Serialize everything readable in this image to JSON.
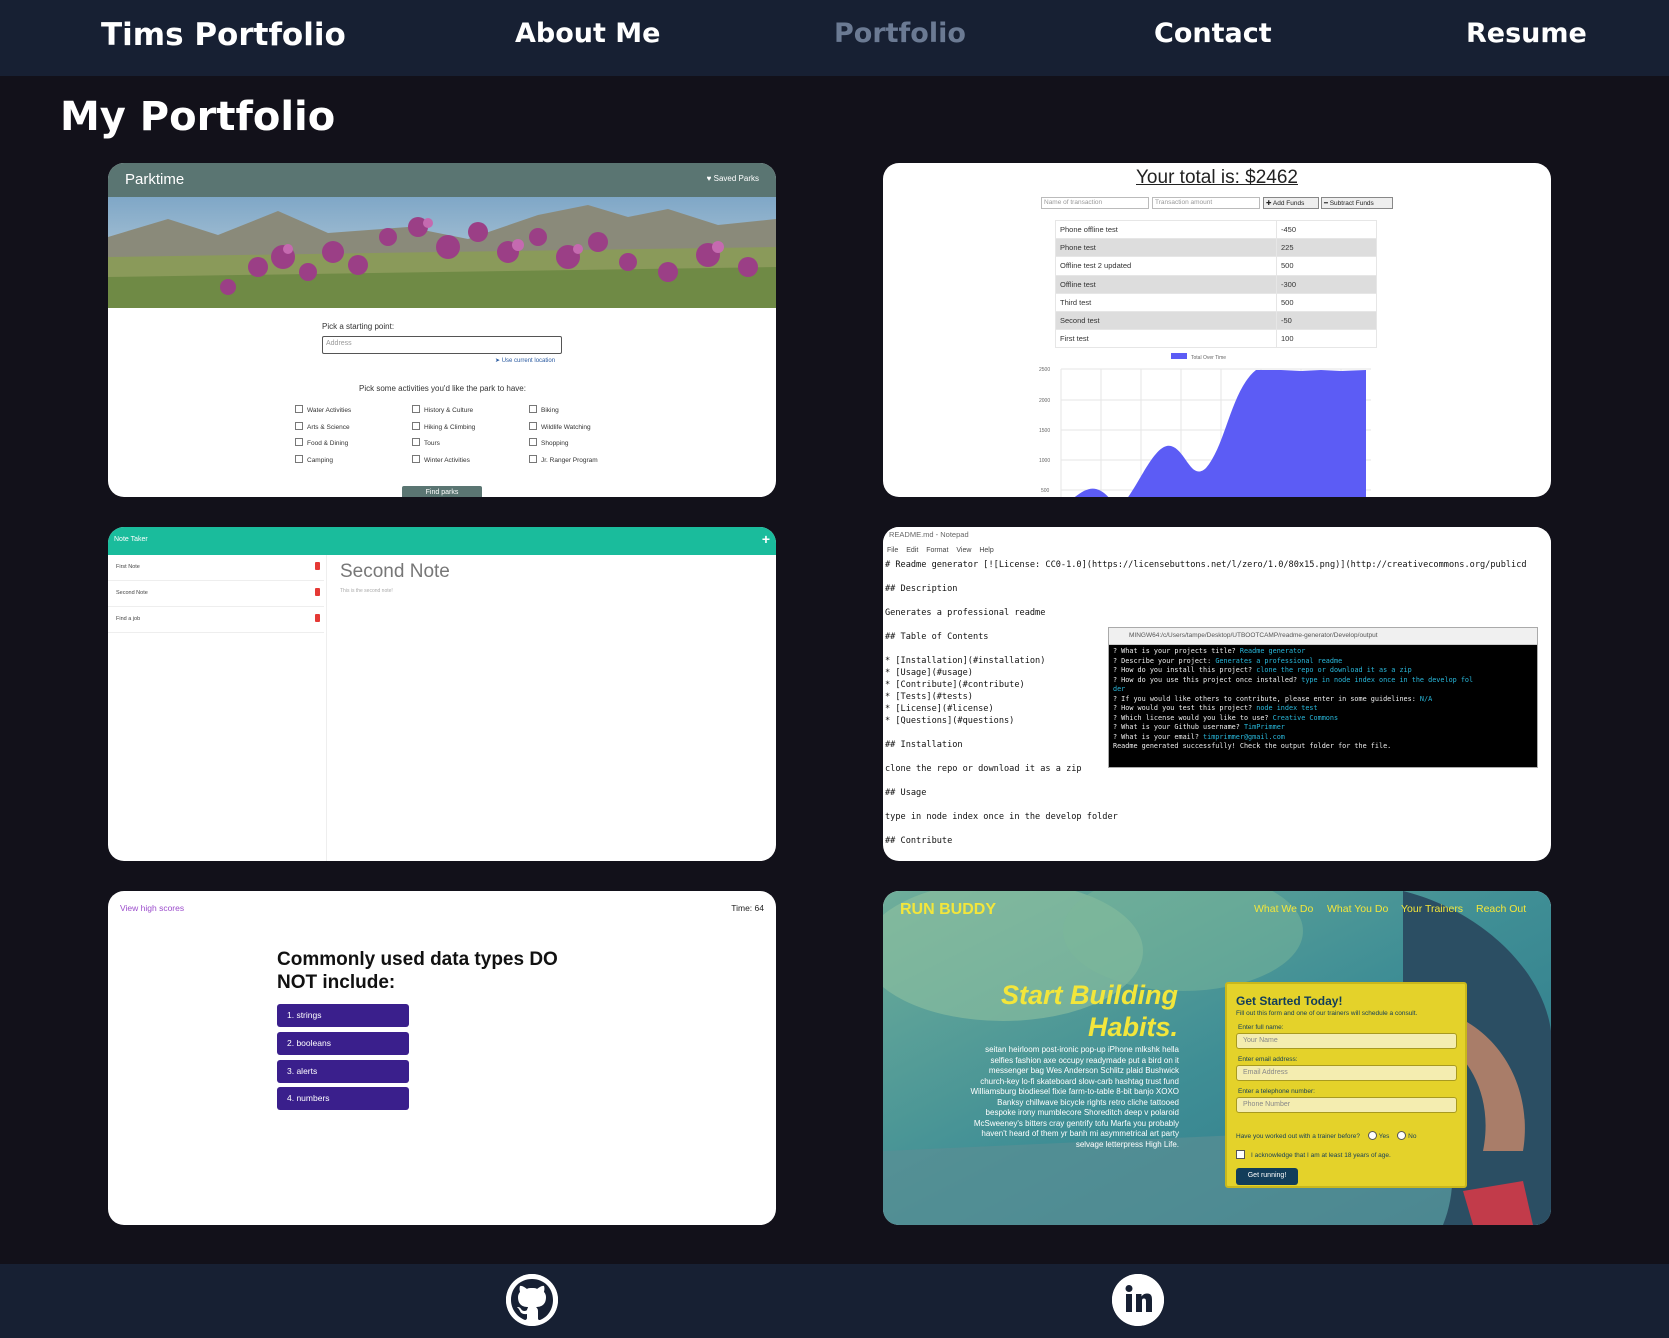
{
  "nav": {
    "brand": "Tims Portfolio",
    "items": [
      "About Me",
      "Portfolio",
      "Contact",
      "Resume"
    ],
    "active": "Portfolio",
    "active_color": "#6b7a93"
  },
  "page_title": "My Portfolio",
  "projects": {
    "parktime": {
      "title": "Parktime",
      "saved": "♥ Saved Parks",
      "start_label": "Pick a starting point:",
      "address_placeholder": "Address",
      "use_location": "➤ Use current location",
      "activities_label": "Pick some activities you'd like the park to have:",
      "activities": [
        "Water Activities",
        "History & Culture",
        "Biking",
        "Arts & Science",
        "Hiking & Climbing",
        "Wildlife Watching",
        "Food & Dining",
        "Tours",
        "Shopping",
        "Camping",
        "Winter Activities",
        "Jr. Ranger Program"
      ],
      "button": "Find parks"
    },
    "budget": {
      "total": "Your total is: $2462",
      "name_placeholder": "Name of transaction",
      "amount_placeholder": "Transaction amount",
      "add_button": "✚ Add Funds",
      "subtract_button": "━ Subtract Funds",
      "transactions": [
        {
          "name": "Phone offline test",
          "amount": "-450"
        },
        {
          "name": "Phone test",
          "amount": "225"
        },
        {
          "name": "Offline test 2 updated",
          "amount": "500"
        },
        {
          "name": "Offline test",
          "amount": "-300"
        },
        {
          "name": "Third test",
          "amount": "500"
        },
        {
          "name": "Second test",
          "amount": "-50"
        },
        {
          "name": "First test",
          "amount": "100"
        }
      ],
      "legend": "Total Over Time",
      "ticks": [
        "2500",
        "2000",
        "1500",
        "1000",
        "500"
      ],
      "fill_color": "#5c5cf5"
    },
    "note_taker": {
      "title": "Note Taker",
      "plus": "+",
      "notes": [
        "First Note",
        "Second Note",
        "Find a job"
      ],
      "active_title": "Second Note",
      "active_body": "This is the second note!"
    },
    "readme": {
      "window_title": "README.md - Notepad",
      "menu": "File Edit Format View Help",
      "lines": [
        "# Readme generator [![License: CC0-1.0](https://licensebuttons.net/l/zero/1.0/80x15.png)](http://creativecommons.org/publicd",
        "## Description",
        "Generates a professional readme",
        "## Table of Contents",
        "* [Installation](#installation)",
        "* [Usage](#usage)",
        "* [Contribute](#contribute)",
        "* [Tests](#tests)",
        "* [License](#license)",
        "* [Questions](#questions)",
        "## Installation",
        "clone the repo or download it as a zip",
        "## Usage",
        "type in node index once in the develop folder",
        "## Contribute"
      ],
      "terminal_title": "MINGW64:/c/Users/tampe/Desktop/UTBOOTCAMP/readme-generator/Develop/output",
      "terminal": [
        {
          "q": "? What is your projects title? ",
          "a": "Readme generator"
        },
        {
          "q": "? Describe your project: ",
          "a": "Generates a professional readme"
        },
        {
          "q": "? How do you install this project? ",
          "a": "clone the repo or download it as a zip"
        },
        {
          "q": "? How do you use this project once installed? ",
          "a": "type in node index once in the develop fol"
        },
        {
          "q": "",
          "a": "der"
        },
        {
          "q": "? If you would like others to contribute, please enter in some guidelines: ",
          "a": "N/A"
        },
        {
          "q": "? How would you test this project? ",
          "a": "node index test"
        },
        {
          "q": "? Which license would you like to use? ",
          "a": "Creative Commons"
        },
        {
          "q": "? What is your Github username? ",
          "a": "TimPrimmer"
        },
        {
          "q": "? What is your email? ",
          "a": "timprimmer@gmail.com"
        },
        {
          "q": "Readme generated successfully! Check the output folder for the file.",
          "a": ""
        }
      ]
    },
    "quiz": {
      "high_scores": "View high scores",
      "time": "Time: 64",
      "question": "Commonly used data types DO NOT include:",
      "answers": [
        "1. strings",
        "2. booleans",
        "3. alerts",
        "4. numbers"
      ]
    },
    "run_buddy": {
      "logo": "RUN BUDDY",
      "nav": [
        "What We Do",
        "What You Do",
        "Your Trainers",
        "Reach Out"
      ],
      "headline": "Start Building Habits.",
      "body": "seitan heirloom post-ironic pop-up iPhone mlkshk hella selfies fashion axe occupy readymade put a bird on it messenger bag Wes Anderson Schlitz plaid Bushwick church-key lo-fi skateboard slow-carb hashtag trust fund Williamsburg biodiesel fixie farm-to-table 8-bit banjo XOXO Banksy chillwave bicycle rights retro cliche tattooed bespoke irony mumblecore Shoreditch deep v polaroid McSweeney's bitters cray gentrify tofu Marfa you probably haven't heard of them yr banh mi asymmetrical art party selvage letterpress High Life.",
      "form_title": "Get Started Today!",
      "form_sub": "Fill out this form and one of our trainers will schedule a consult.",
      "name_label": "Enter full name:",
      "name_placeholder": "Your Name",
      "email_label": "Enter email address:",
      "email_placeholder": "Email Address",
      "phone_label": "Enter a telephone number:",
      "phone_placeholder": "Phone Number",
      "question": "Have you worked out with a trainer before?",
      "yes": "Yes",
      "no": "No",
      "acknowledge": "I acknowledge that I am at least 18 years of age.",
      "button": "Get running!"
    }
  },
  "footer": {
    "icons": [
      "github-icon",
      "linkedin-icon"
    ]
  }
}
